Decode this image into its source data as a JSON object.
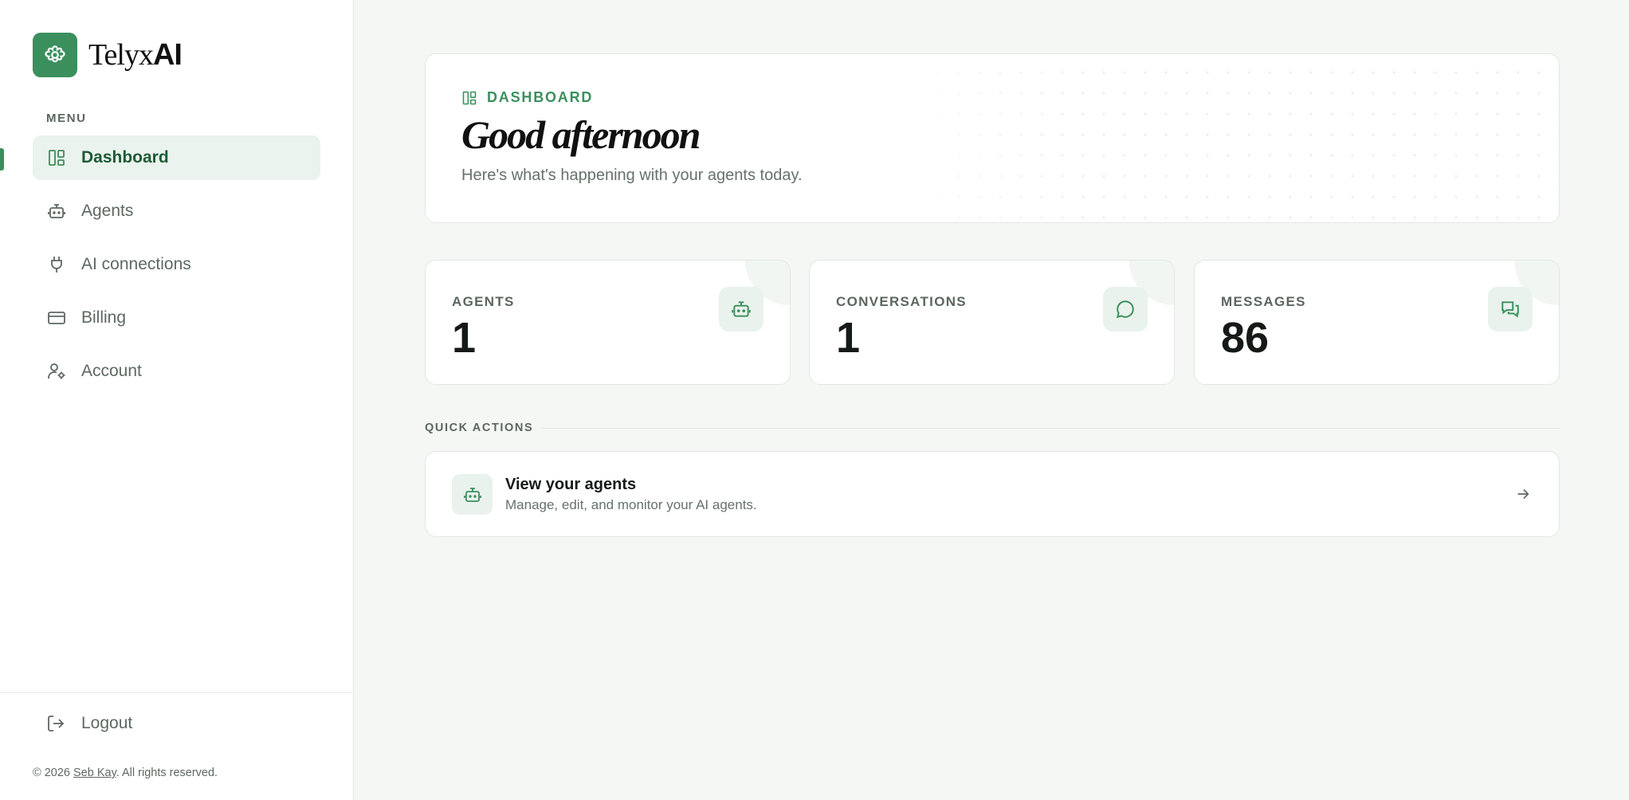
{
  "brand": {
    "name_light": "Telyx",
    "name_bold": "AI",
    "logo_icon": "gear-flower-icon",
    "accent": "#3b8f5c"
  },
  "sidebar": {
    "menu_label": "MENU",
    "items": [
      {
        "label": "Dashboard",
        "icon": "dashboard-icon",
        "active": true
      },
      {
        "label": "Agents",
        "icon": "robot-icon",
        "active": false
      },
      {
        "label": "AI connections",
        "icon": "plug-icon",
        "active": false
      },
      {
        "label": "Billing",
        "icon": "credit-card-icon",
        "active": false
      },
      {
        "label": "Account",
        "icon": "user-gear-icon",
        "active": false
      }
    ],
    "logout_label": "Logout",
    "copyright_prefix": "© 2026 ",
    "copyright_link": "Seb Kay",
    "copyright_suffix": ". All rights reserved."
  },
  "hero": {
    "eyebrow": "DASHBOARD",
    "title": "Good afternoon",
    "subtitle": "Here's what's happening with your agents today."
  },
  "stats": [
    {
      "label": "AGENTS",
      "value": "1",
      "icon": "robot-icon"
    },
    {
      "label": "CONVERSATIONS",
      "value": "1",
      "icon": "chat-bubble-icon"
    },
    {
      "label": "MESSAGES",
      "value": "86",
      "icon": "chat-bubbles-icon"
    }
  ],
  "quick_actions": {
    "header": "QUICK ACTIONS",
    "items": [
      {
        "title": "View your agents",
        "subtitle": "Manage, edit, and monitor your AI agents.",
        "icon": "robot-icon"
      }
    ]
  }
}
